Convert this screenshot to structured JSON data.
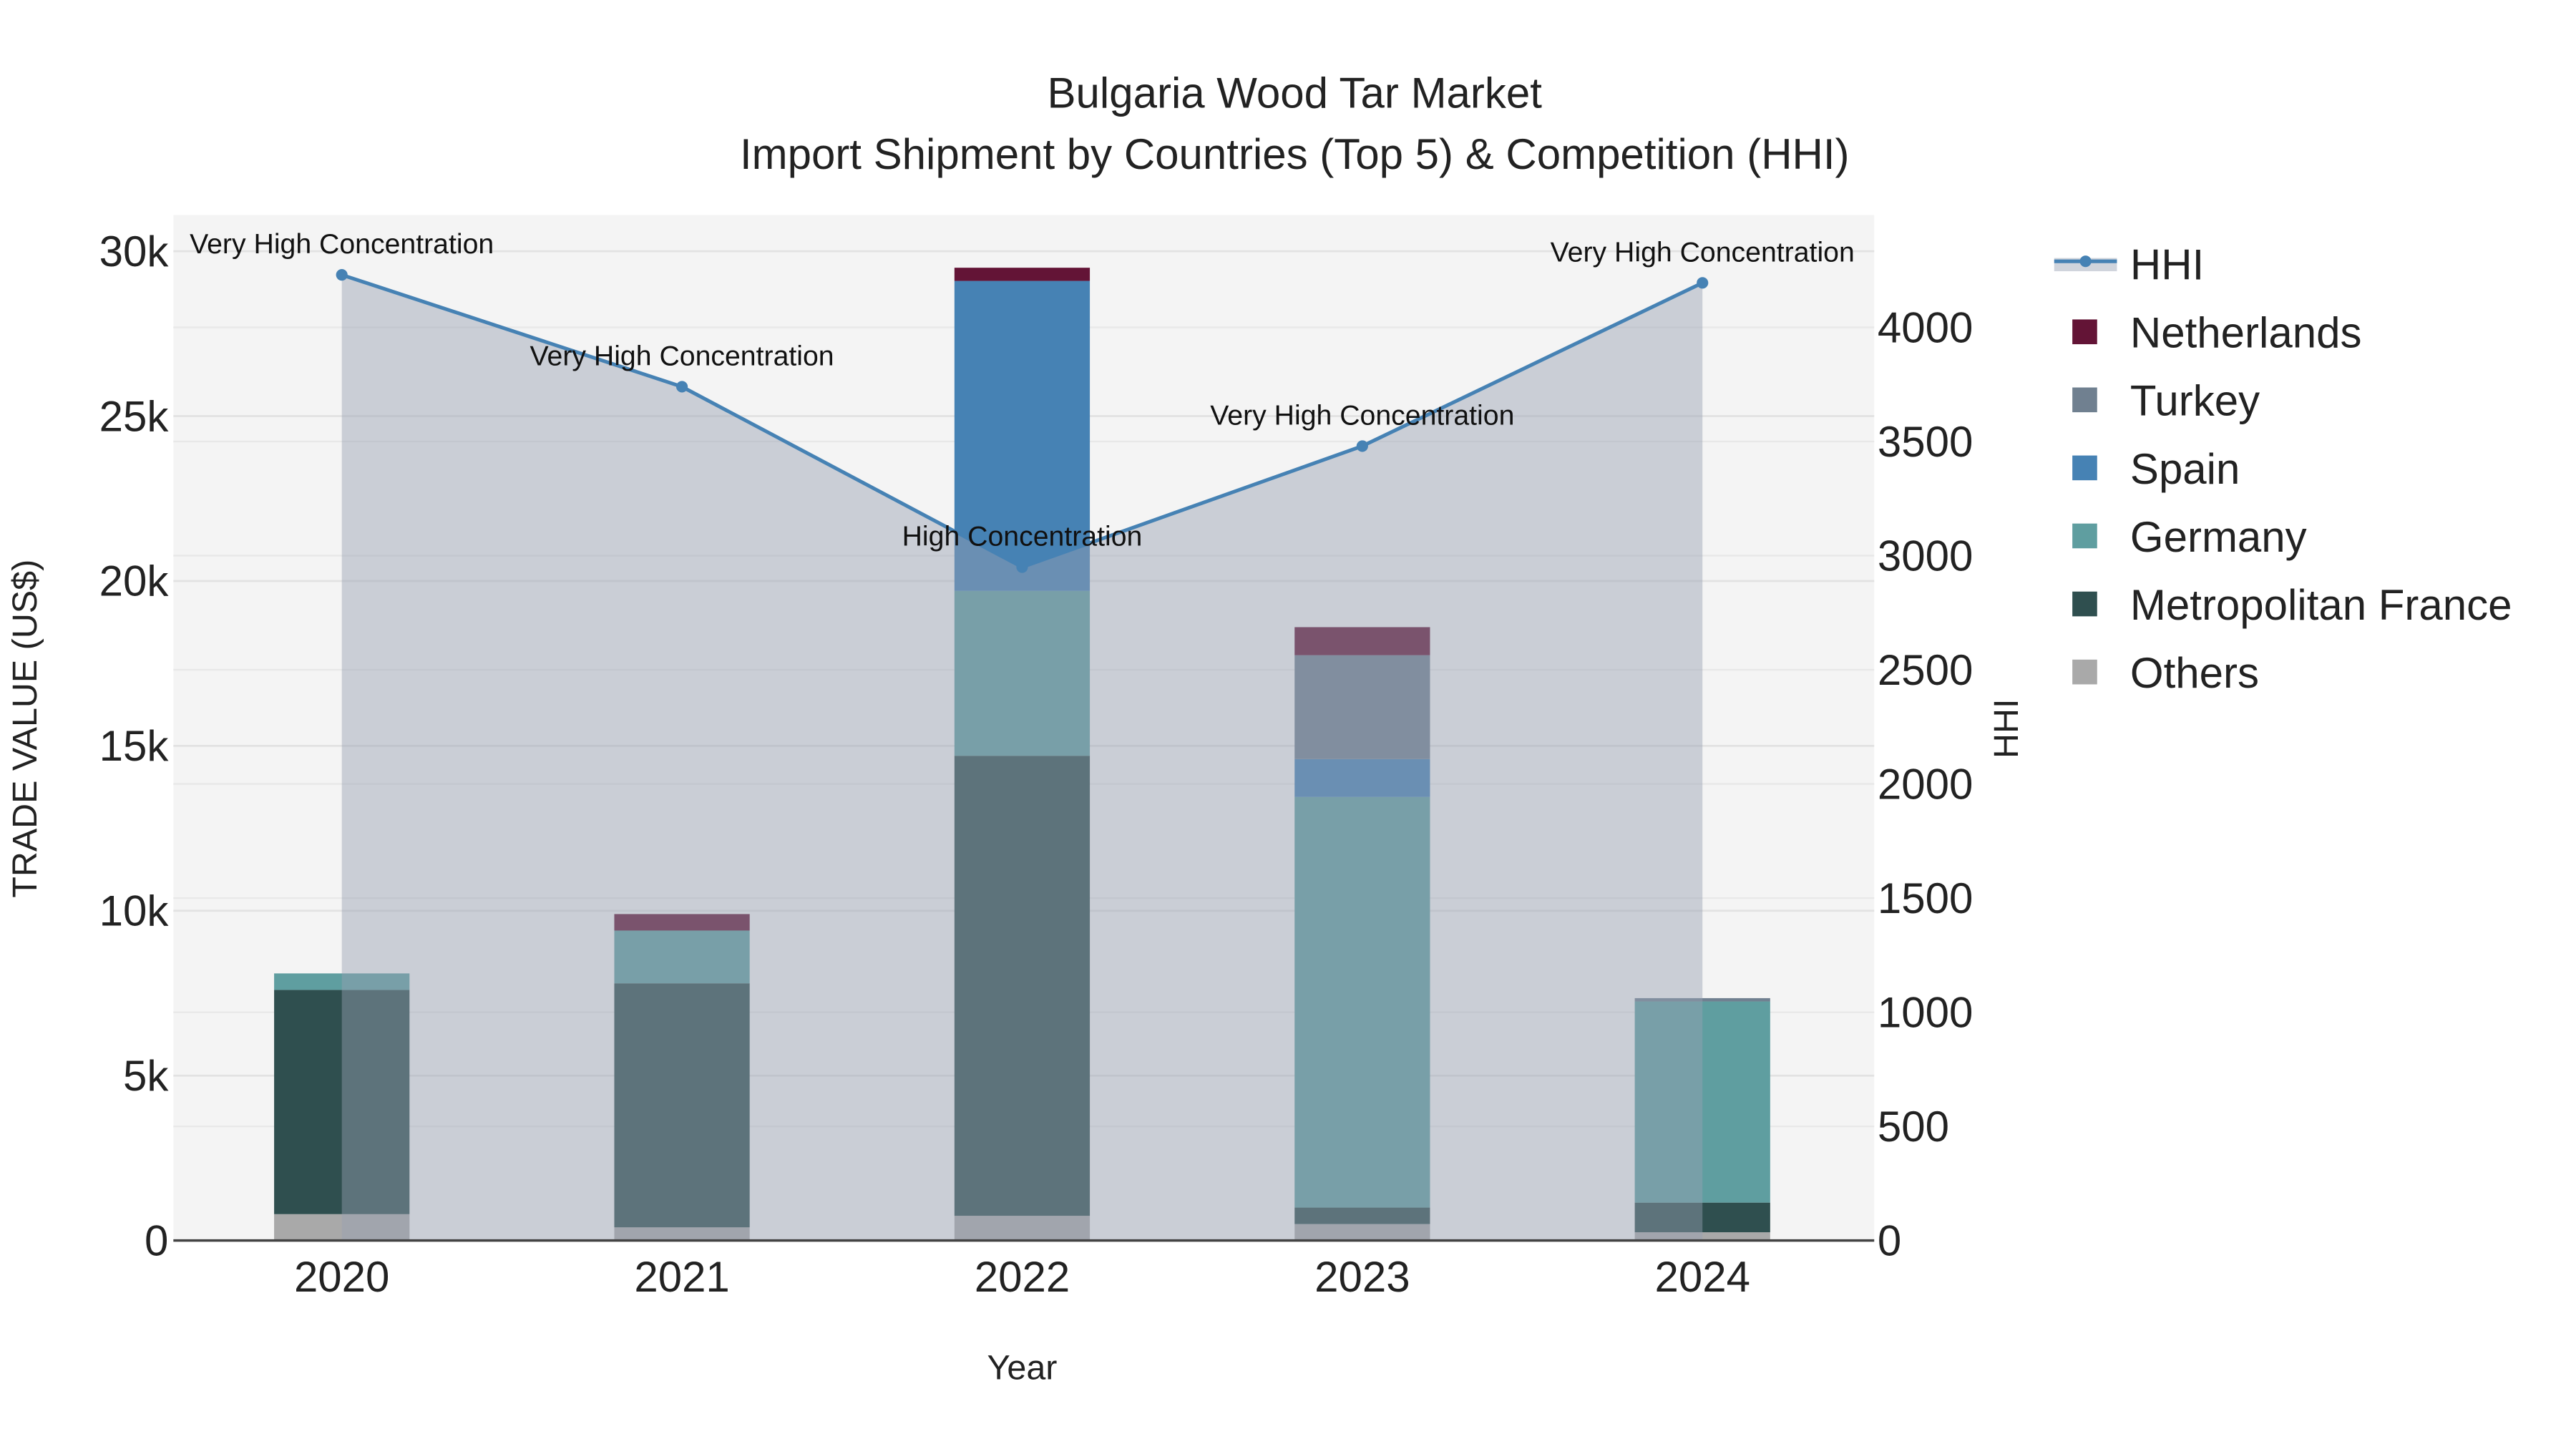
{
  "chart_data": {
    "type": "bar",
    "title": "Bulgaria Wood Tar Market",
    "subtitle": "Import Shipment by Countries (Top 5) & Competition (HHI)",
    "xlabel": "Year",
    "ylabel": "TRADE VALUE (US$)",
    "y2label": "HHI",
    "categories": [
      "2020",
      "2021",
      "2022",
      "2023",
      "2024"
    ],
    "ylim": [
      0,
      31000
    ],
    "y2lim": [
      0,
      4500
    ],
    "yticks": [
      {
        "v": 0,
        "label": "0"
      },
      {
        "v": 5000,
        "label": "5k"
      },
      {
        "v": 10000,
        "label": "10k"
      },
      {
        "v": 15000,
        "label": "15k"
      },
      {
        "v": 20000,
        "label": "20k"
      },
      {
        "v": 25000,
        "label": "25k"
      },
      {
        "v": 30000,
        "label": "30k"
      }
    ],
    "y2ticks": [
      {
        "v": 0,
        "label": "0"
      },
      {
        "v": 500,
        "label": "500"
      },
      {
        "v": 1000,
        "label": "1000"
      },
      {
        "v": 1500,
        "label": "1500"
      },
      {
        "v": 2000,
        "label": "2000"
      },
      {
        "v": 2500,
        "label": "2500"
      },
      {
        "v": 3000,
        "label": "3000"
      },
      {
        "v": 3500,
        "label": "3500"
      },
      {
        "v": 4000,
        "label": "4000"
      }
    ],
    "grid": true,
    "legend_placement": "right",
    "series": [
      {
        "name": "Others",
        "color": "#a9a9a9",
        "values": [
          800,
          400,
          750,
          500,
          250
        ]
      },
      {
        "name": "Metropolitan France",
        "color": "#2f4f4f",
        "values": [
          6800,
          7400,
          13950,
          500,
          900
        ]
      },
      {
        "name": "Germany",
        "color": "#5f9ea0",
        "values": [
          500,
          1600,
          5000,
          12450,
          6100
        ]
      },
      {
        "name": "Spain",
        "color": "#4682b4",
        "values": [
          0,
          0,
          9400,
          1150,
          0
        ]
      },
      {
        "name": "Turkey",
        "color": "#708090",
        "values": [
          0,
          0,
          0,
          3150,
          100
        ]
      },
      {
        "name": "Netherlands",
        "color": "#631436",
        "values": [
          0,
          500,
          400,
          850,
          0
        ]
      }
    ],
    "hhi": {
      "name": "HHI",
      "color": "#4682b4",
      "values": [
        4230,
        3740,
        2950,
        3480,
        4195
      ],
      "annotations": [
        "Very High Concentration",
        "Very High Concentration",
        "High Concentration",
        "Very High Concentration",
        "Very High Concentration"
      ]
    },
    "legend": [
      "HHI",
      "Netherlands",
      "Turkey",
      "Spain",
      "Germany",
      "Metropolitan France",
      "Others"
    ]
  }
}
